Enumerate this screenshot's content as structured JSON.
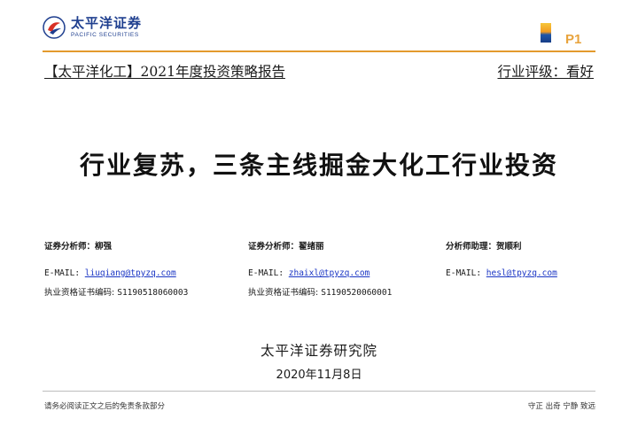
{
  "header": {
    "logo_cn": "太平洋证券",
    "logo_en": "PACIFIC SECURITIES",
    "page_label": "P1",
    "subtitle": "【太平洋化工】2021年度投资策略报告",
    "rating": "行业评级：看好",
    "colors": {
      "brand_blue": "#1f3f8f",
      "accent_orange": "#e39a2d",
      "link_blue": "#1a35c4"
    }
  },
  "title": "行业复苏，三条主线掘金大化工行业投资",
  "analysts": [
    {
      "role": "证券分析师：柳强",
      "email_label": "E-MAIL: ",
      "email": "liuqiang@tpyzq.com",
      "cert_label": "执业资格证书编码: ",
      "cert": "S1190518060003"
    },
    {
      "role": "证券分析师：翟绪丽",
      "email_label": "E-MAIL: ",
      "email": "zhaixl@tpyzq.com",
      "cert_label": "执业资格证书编码: ",
      "cert": "S1190520060001"
    },
    {
      "role": "分析师助理：贺顺利",
      "email_label": "E-MAIL: ",
      "email": "hesl@tpyzq.com"
    }
  ],
  "institute": "太平洋证券研究院",
  "date": "2020年11月8日",
  "footer": {
    "disclaimer": "请务必阅读正文之后的免责条款部分",
    "motto": "守正 出奇 宁静 致远"
  }
}
